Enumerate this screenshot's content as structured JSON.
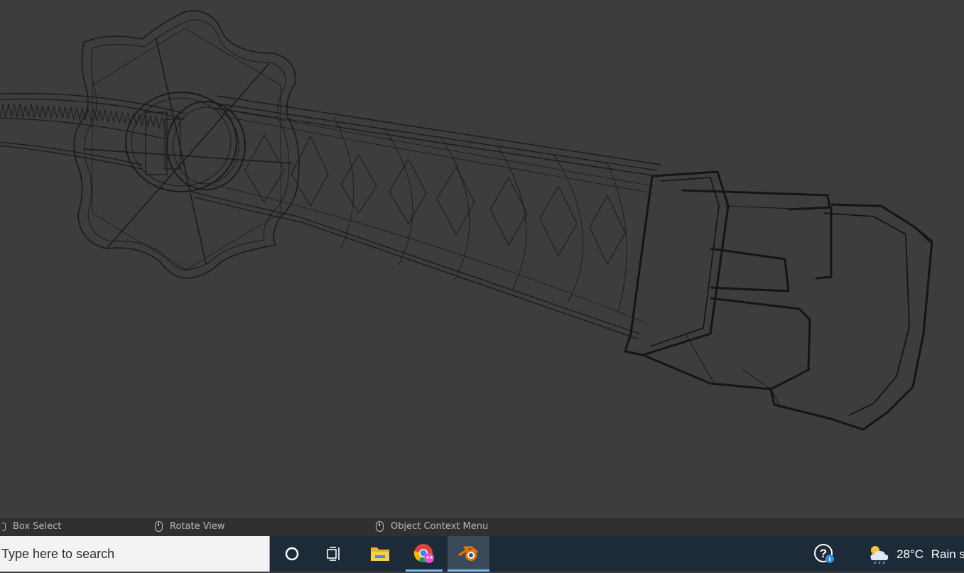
{
  "viewport": {
    "background": "#3d3d3d",
    "wire_color": "#1b1b1b"
  },
  "statusbar": {
    "hints": [
      {
        "icon": "mouse-left-icon",
        "label": "Box Select"
      },
      {
        "icon": "mouse-middle-icon",
        "label": "Rotate View"
      },
      {
        "icon": "mouse-right-icon",
        "label": "Object Context Menu"
      }
    ]
  },
  "taskbar": {
    "search_placeholder": "Type here to search",
    "buttons": [
      {
        "icon": "cortana-icon"
      },
      {
        "icon": "task-view-icon"
      },
      {
        "icon": "file-explorer-icon"
      },
      {
        "icon": "chrome-icon",
        "running": true
      },
      {
        "icon": "blender-icon",
        "active": true
      }
    ],
    "help_icon": "help-icon",
    "weather": {
      "icon": "weather-rain-icon",
      "temp": "28°C",
      "condition": "Rain s"
    },
    "accent": "#76b9ed"
  }
}
